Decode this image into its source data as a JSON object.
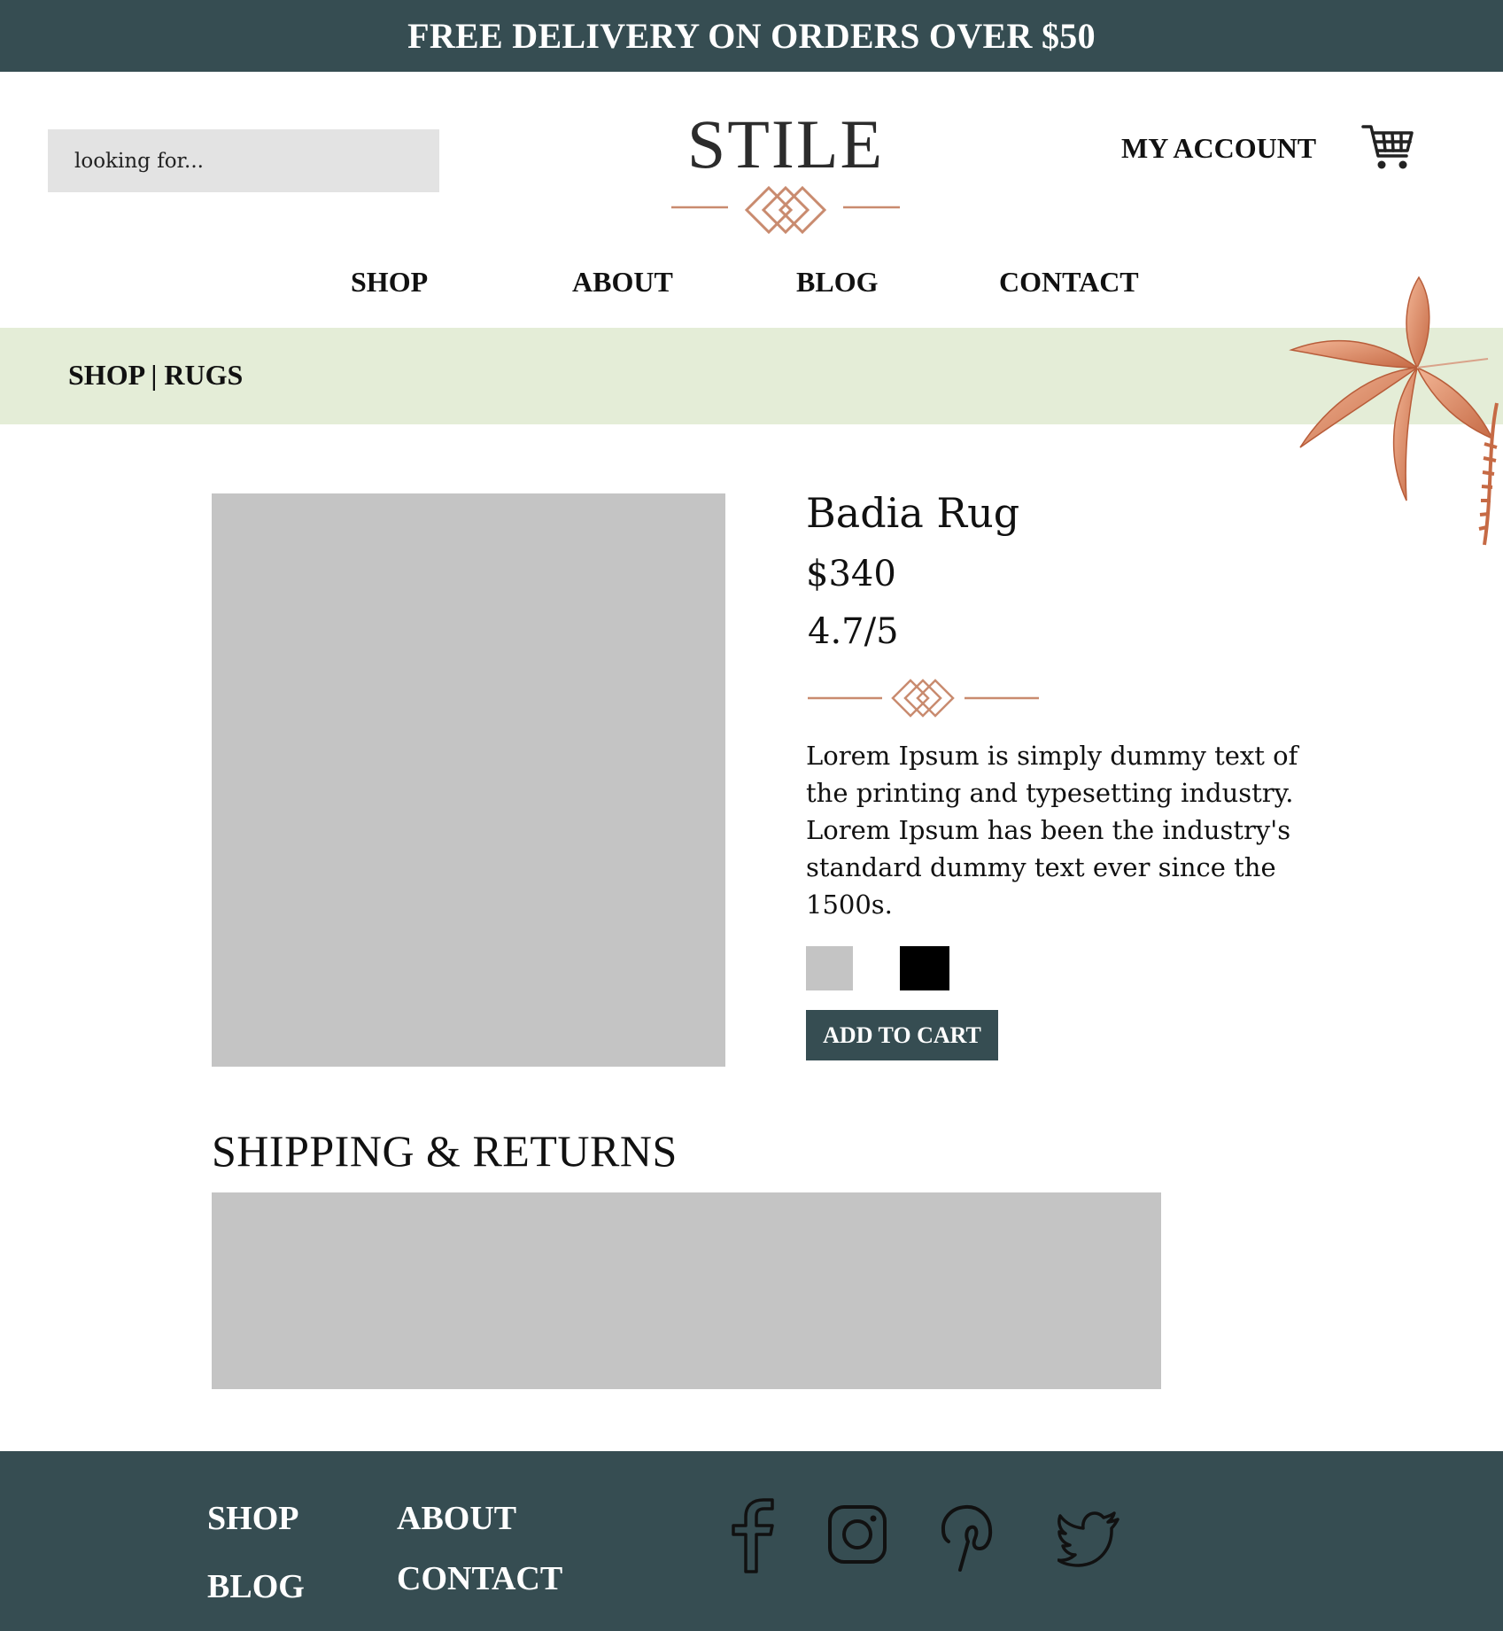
{
  "banner": {
    "text": "FREE DELIVERY ON ORDERS OVER $50"
  },
  "header": {
    "search_placeholder": "looking for...",
    "logo": "STILE",
    "account_label": "MY ACCOUNT"
  },
  "nav": {
    "items": [
      "SHOP",
      "ABOUT",
      "BLOG",
      "CONTACT"
    ]
  },
  "breadcrumb": "SHOP | RUGS",
  "product": {
    "title": "Badia Rug",
    "price": "$340",
    "rating": "4.7/5",
    "description": "Lorem Ipsum is simply dummy text of the printing and typesetting industry. Lorem Ipsum has been the industry's standard dummy text ever since the 1500s.",
    "swatches": [
      "#c4c4c4",
      "#000000"
    ],
    "add_to_cart": "ADD TO CART"
  },
  "shipping": {
    "title": "SHIPPING & RETURNS"
  },
  "footer": {
    "links": [
      "SHOP",
      "ABOUT",
      "BLOG",
      "CONTACT"
    ],
    "social": [
      "facebook-icon",
      "instagram-icon",
      "pinterest-icon",
      "twitter-icon"
    ]
  },
  "colors": {
    "brand": "#364d52",
    "accent": "#c98b6f",
    "band": "#e4edd7",
    "placeholder": "#c4c4c4"
  }
}
